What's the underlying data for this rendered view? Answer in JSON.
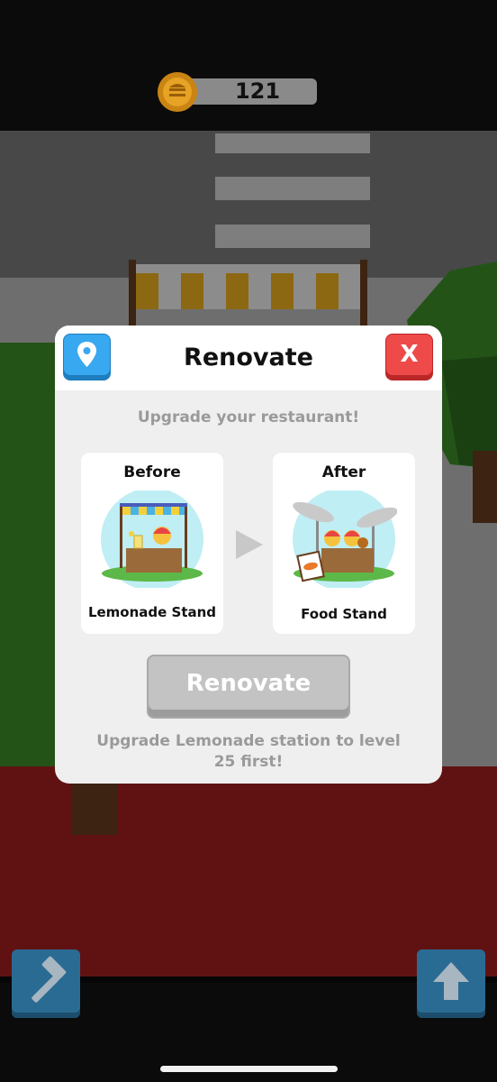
{
  "hud": {
    "coins": "121",
    "coin_icon": "coin-icon"
  },
  "modal": {
    "title": "Renovate",
    "location_icon": "map-pin-icon",
    "close_label": "X",
    "subtitle": "Upgrade your restaurant!",
    "before": {
      "heading": "Before",
      "name": "Lemonade Stand"
    },
    "after": {
      "heading": "After",
      "name": "Food Stand"
    },
    "renovate_button": "Renovate",
    "requirement": "Upgrade Lemonade station to level 25 first!"
  },
  "bottom_bar": {
    "left_icon": "hammer-icon",
    "right_icon": "arrow-up-icon"
  },
  "colors": {
    "location_button": "#38a8f0",
    "close_button": "#ef4a4a",
    "disabled_button": "#c3c3c3",
    "action_buttons": "#2a6b93"
  }
}
